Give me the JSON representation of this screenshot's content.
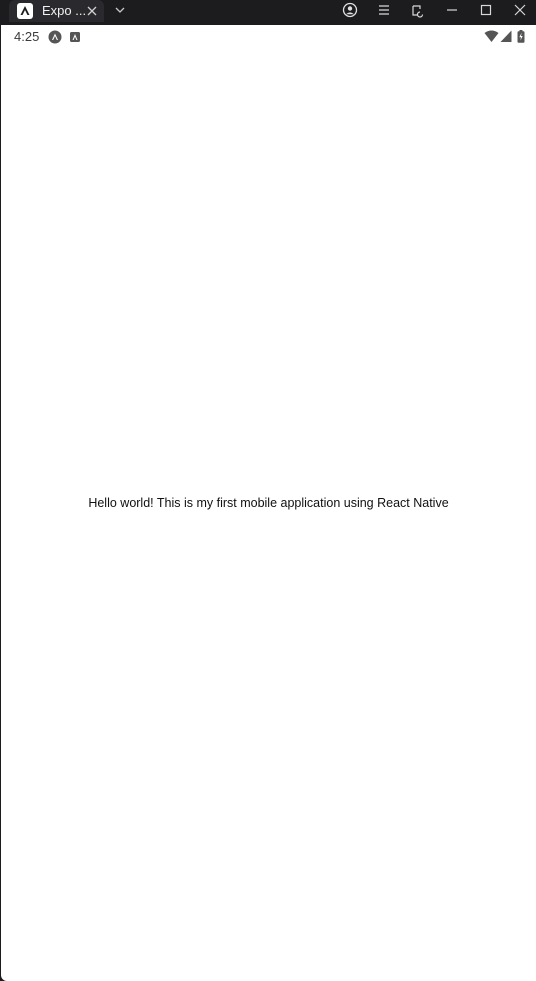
{
  "window": {
    "tab_title": "Expo ...",
    "icons": [
      "expo-logo-icon",
      "close-icon",
      "chevron-down-icon",
      "account-icon",
      "menu-icon",
      "rotate-icon",
      "minimize-icon",
      "maximize-icon",
      "close-icon"
    ]
  },
  "device": {
    "status_time": "4:25",
    "status_icons": [
      "expo-notification-icon",
      "android-notification-icon",
      "wifi-icon",
      "signal-icon",
      "battery-charging-icon"
    ]
  },
  "app": {
    "message": "Hello world! This is my first mobile application using React Native",
    "background": "#ffffff"
  },
  "colors": {
    "chrome_background": "#1c1c1f",
    "tab_background": "#2a2a2e"
  }
}
